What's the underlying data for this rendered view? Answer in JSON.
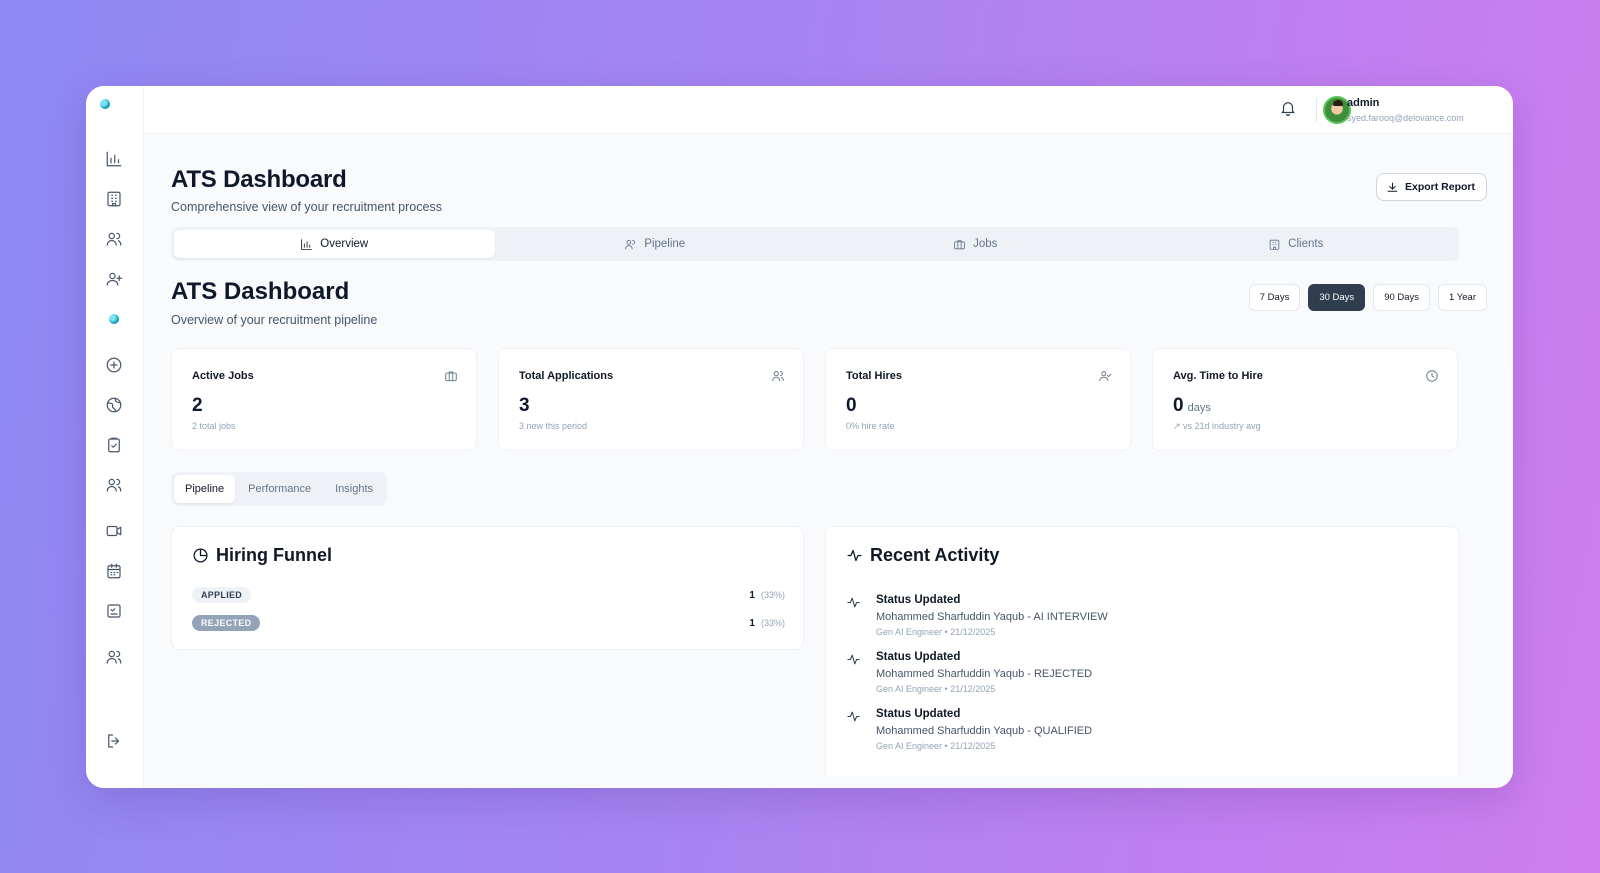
{
  "user": {
    "name": "admin",
    "email": "syed.farooq@delovance.com"
  },
  "header": {
    "title": "ATS Dashboard",
    "subtitle": "Comprehensive view of your recruitment process",
    "export_label": "Export Report"
  },
  "main_tabs": [
    {
      "label": "Overview",
      "icon": "bar-chart-icon",
      "active": true
    },
    {
      "label": "Pipeline",
      "icon": "users-icon",
      "active": false
    },
    {
      "label": "Jobs",
      "icon": "briefcase-icon",
      "active": false
    },
    {
      "label": "Clients",
      "icon": "building-icon",
      "active": false
    }
  ],
  "dashboard": {
    "title": "ATS Dashboard",
    "subtitle": "Overview of your recruitment pipeline",
    "periods": [
      {
        "label": "7 Days",
        "active": false
      },
      {
        "label": "30 Days",
        "active": true
      },
      {
        "label": "90 Days",
        "active": false
      },
      {
        "label": "1 Year",
        "active": false
      }
    ]
  },
  "stats": [
    {
      "title": "Active Jobs",
      "value": "2",
      "unit": "",
      "note": "2 total jobs",
      "icon": "briefcase-icon"
    },
    {
      "title": "Total Applications",
      "value": "3",
      "unit": "",
      "note": "3 new this period",
      "icon": "users-icon"
    },
    {
      "title": "Total Hires",
      "value": "0",
      "unit": "",
      "note": "0% hire rate",
      "icon": "user-check-icon"
    },
    {
      "title": "Avg. Time to Hire",
      "value": "0",
      "unit": "days",
      "note": "↗ vs 21d industry avg",
      "icon": "clock-icon"
    }
  ],
  "sub_tabs": [
    {
      "label": "Pipeline",
      "active": true
    },
    {
      "label": "Performance",
      "active": false
    },
    {
      "label": "Insights",
      "active": false
    }
  ],
  "funnel": {
    "title": "Hiring Funnel",
    "rows": [
      {
        "stage": "APPLIED",
        "count": "1",
        "pct": "(33%)"
      },
      {
        "stage": "REJECTED",
        "count": "1",
        "pct": "(33%)"
      }
    ]
  },
  "activity": {
    "title": "Recent Activity",
    "items": [
      {
        "title": "Status Updated",
        "desc": "Mohammed Sharfuddin Yaqub - AI INTERVIEW",
        "meta": "Gen AI Engineer • 21/12/2025"
      },
      {
        "title": "Status Updated",
        "desc": "Mohammed Sharfuddin Yaqub - REJECTED",
        "meta": "Gen AI Engineer • 21/12/2025"
      },
      {
        "title": "Status Updated",
        "desc": "Mohammed Sharfuddin Yaqub - QUALIFIED",
        "meta": "Gen AI Engineer • 21/12/2025"
      }
    ]
  },
  "colors": {
    "accent_dark": "#2f3d4f",
    "logo": "#18a3c2",
    "badge_rejected": "#94a3b8"
  }
}
